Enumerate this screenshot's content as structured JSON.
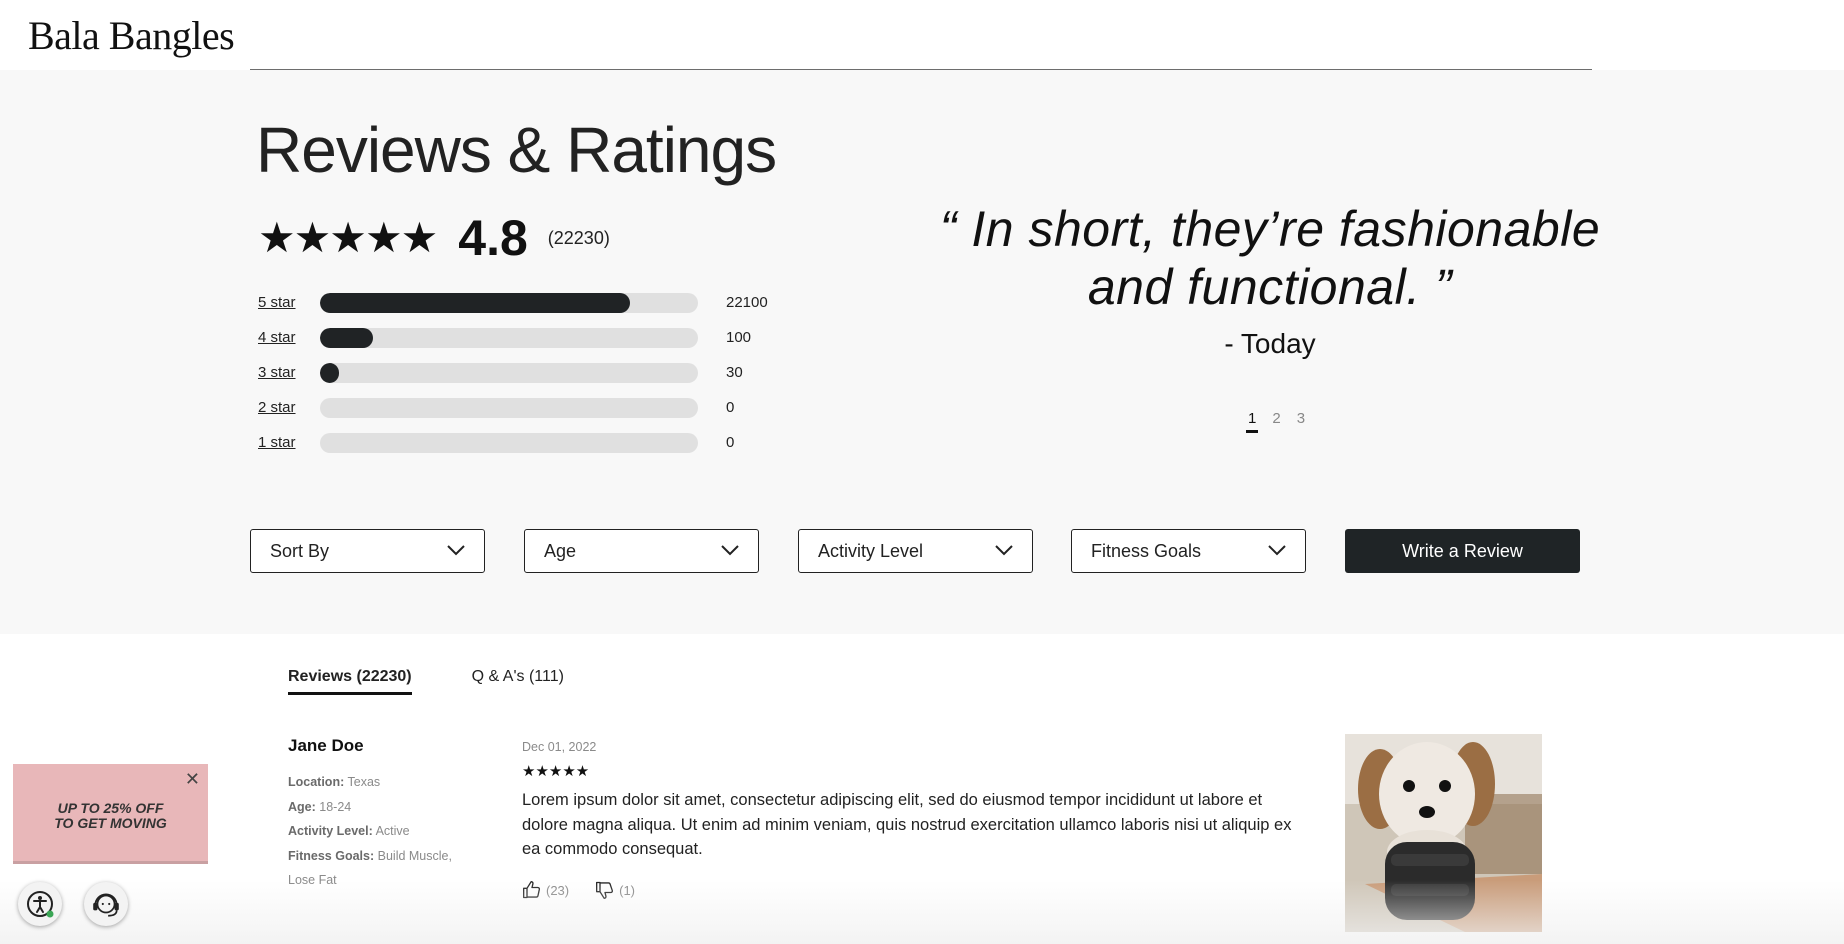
{
  "header": {
    "logo": "Bala Bangles"
  },
  "summary": {
    "title": "Reviews & Ratings",
    "stars": "★★★★★",
    "average": "4.8",
    "total_count": "(22230)",
    "rating": 4.8,
    "breakdown": [
      {
        "label": "5 star",
        "count": "22100",
        "fill_percent": 82
      },
      {
        "label": "4 star",
        "count": "100",
        "fill_percent": 14
      },
      {
        "label": "3 star",
        "count": "30",
        "fill_percent": 5
      },
      {
        "label": "2 star",
        "count": "0",
        "fill_percent": 0
      },
      {
        "label": "1 star",
        "count": "0",
        "fill_percent": 0
      }
    ]
  },
  "quote": {
    "open_mark": "“",
    "text": "In short, they’re fashionable and functional.",
    "close_mark": "”",
    "author": "- Today",
    "pages": [
      "1",
      "2",
      "3"
    ],
    "active_page": "1"
  },
  "filters": {
    "sort_by": "Sort By",
    "age": "Age",
    "activity_level": "Activity Level",
    "fitness_goals": "Fitness Goals",
    "write_review": "Write a Review"
  },
  "tabs": {
    "reviews": "Reviews (22230)",
    "qa": "Q & A's (111)"
  },
  "review": {
    "name": "Jane Doe",
    "location_label": "Location:",
    "location": "Texas",
    "age_label": "Age:",
    "age": "18-24",
    "activity_label": "Activity Level:",
    "activity": "Active",
    "goals_label": "Fitness Goals:",
    "goals": "Build Muscle, Lose Fat",
    "date": "Dec 01, 2022",
    "stars": "★★★★★",
    "body": "Lorem ipsum dolor sit amet, consectetur adipiscing elit, sed do eiusmod tempor incididunt ut labore et dolore magna aliqua. Ut enim ad minim veniam, quis nostrud exercitation ullamco laboris nisi ut aliquip ex ea commodo consequat.",
    "helpful_count": "(23)",
    "unhelpful_count": "(1)"
  },
  "promo": {
    "line1": "UP TO 25% OFF",
    "line2": "TO GET MOVING",
    "close": "✕"
  },
  "colors": {
    "dark": "#1f2426",
    "promo_bg": "#e8b7b9",
    "section_bg": "#f8f8f8",
    "bar_track": "#e0e0e0"
  }
}
